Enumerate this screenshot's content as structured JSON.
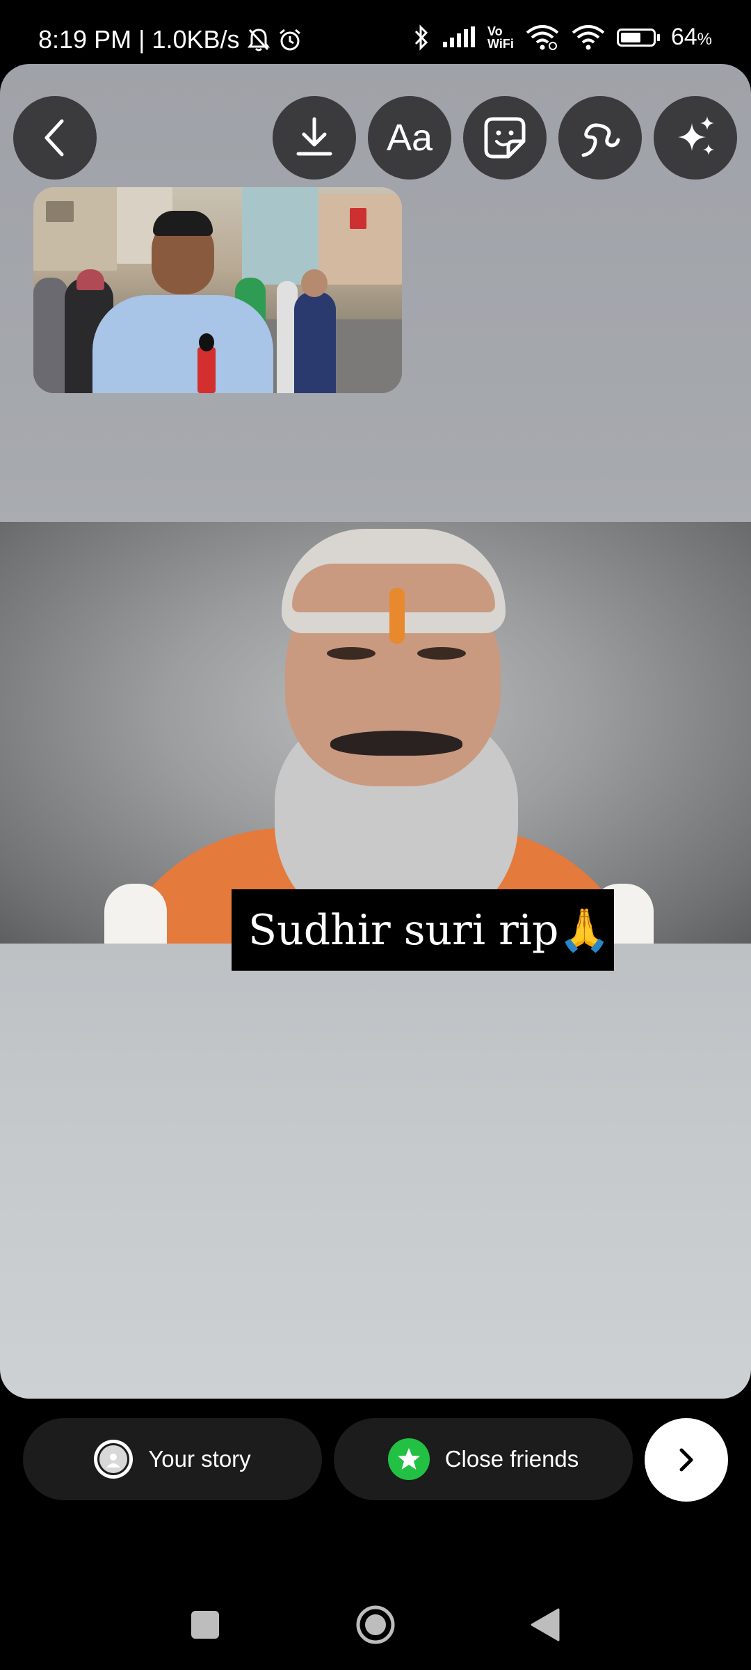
{
  "status_bar": {
    "time": "8:19 PM",
    "separator": "|",
    "network_speed": "1.0KB/s",
    "wifi_calling": "Vo\nWiFi",
    "battery_percent": "64",
    "battery_unit": "%"
  },
  "toolbar": {
    "text_tool_label": "Aa",
    "icons": [
      "back-icon",
      "download-icon",
      "text-icon",
      "sticker-icon",
      "draw-icon",
      "effects-icon"
    ]
  },
  "caption": {
    "text": "Sudhir suri rip🙏"
  },
  "share": {
    "your_story_label": "Your story",
    "close_friends_label": "Close friends"
  },
  "colors": {
    "toolbar_button": "#3b3b3d",
    "share_pill": "#1c1c1d",
    "close_friends_green": "#22c143"
  }
}
